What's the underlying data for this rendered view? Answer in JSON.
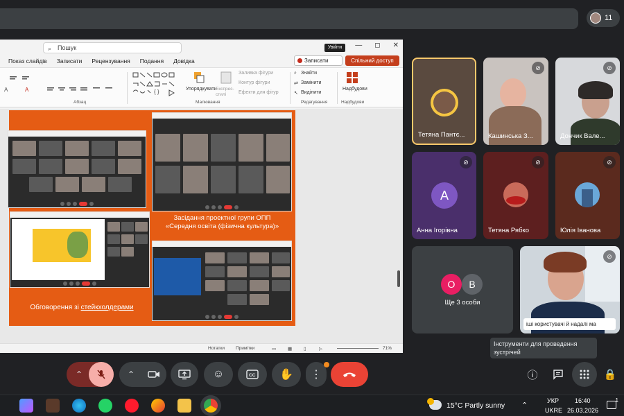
{
  "meet": {
    "participant_count": "11",
    "more_people_label": "Ще 3 особи",
    "more_people_initials": [
      "О",
      "В"
    ],
    "caption_text": "іші користувачі й надалі ма",
    "tooltip_text": "Інструменти для проведення зустрічей",
    "participants": [
      {
        "name": "Тетяна Пантє..."
      },
      {
        "name": "Кашинська З..."
      },
      {
        "name": "Дончик Вале..."
      },
      {
        "name": "Анна Ігорівна",
        "initial": "A"
      },
      {
        "name": "Тетяна Рябко"
      },
      {
        "name": "Юлія Іванова"
      }
    ],
    "colors": {
      "end_call": "#ea4335",
      "active_speaker_border": "#f9c96b",
      "muted_mic_bg": "#f6aea9"
    }
  },
  "ppt": {
    "search_placeholder": "Пошук",
    "sign_in": "Увійти",
    "menu": [
      "Показ слайдів",
      "Записати",
      "Рецензування",
      "Подання",
      "Довідка"
    ],
    "record_button": "Записати",
    "share_button": "Спільний доступ",
    "ribbon": {
      "paragraph_group": "Абзац",
      "drawing_group": "Малювання",
      "editing_group": "Редагування",
      "addins_group": "Надбудови",
      "arrange": "Упорядкувати",
      "quick_styles": "Експрес-стилі",
      "shape_fill": "Заливка фігури",
      "shape_outline": "Контур фігури",
      "shape_effects": "Ефекти для фігур",
      "find": "Знайти",
      "replace": "Замінити",
      "select": "Виділити",
      "addins": "Надбудови"
    },
    "slide": {
      "caption_right": "Засідання проектної групи ОПП «Середня освіта (фізична культура)»",
      "caption_bottom_prefix": "Обговорення зі ",
      "caption_bottom_link": "стейкхолдерами"
    },
    "status": {
      "notes": "Нотатки",
      "comments": "Примітки",
      "zoom": "71%"
    }
  },
  "taskbar": {
    "weather": "15°C  Partly sunny",
    "lang_top": "УКР",
    "lang_bottom": "UKRE",
    "time": "16:40",
    "date": "26.03.2026",
    "notifications": "1"
  }
}
